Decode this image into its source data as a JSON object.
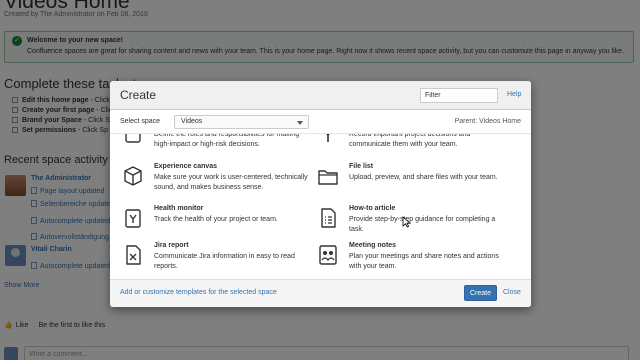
{
  "page": {
    "title": "Videos Home",
    "created_by": "Created by The Administrator on Feb 08, 2018"
  },
  "welcome": {
    "title": "Welcome to your new space!",
    "body": "Confluence spaces are great for sharing content and news with your team. This is your home page. Right now it shows recent space activity, but you can customize this page in anyway you like."
  },
  "tasks": {
    "heading": "Complete these tasks to",
    "items": [
      {
        "label": "Edit this home page",
        "rest": " - Click"
      },
      {
        "label": "Create your first page",
        "rest": " - Click"
      },
      {
        "label": "Brand your Space",
        "rest": " - Click Sp"
      },
      {
        "label": "Set permissions",
        "rest": " - Click Sp"
      }
    ]
  },
  "recent": {
    "heading": "Recent space activity",
    "groups": [
      {
        "user": "The Administrator",
        "lines": [
          "Page layout updated",
          "Seitenbereiche updated",
          "Autocomplete updated",
          "Autovervollständigung"
        ]
      },
      {
        "user": "Vitali Charin",
        "lines": [
          "Autocomplete updated"
        ]
      }
    ],
    "show_more": "Show More"
  },
  "like": {
    "label": "Like",
    "text": "Be the first to like this"
  },
  "comment": {
    "placeholder": "Write a comment..."
  },
  "dialog": {
    "title": "Create",
    "filter_placeholder": "Filter",
    "help": "Help",
    "select_space_label": "Select space",
    "selected_space": "Videos",
    "parent": "Parent: Videos Home",
    "templates": [
      {
        "name": "",
        "desc": "Define the roles and responsibilities for making high-impact or high-risk decisions.",
        "icon": "roles-icon"
      },
      {
        "name": "",
        "desc": "Record important project decisions and communicate them with your team.",
        "icon": "decision-icon"
      },
      {
        "name": "Experience canvas",
        "desc": "Make sure your work is user-centered, technically sound, and makes business sense.",
        "icon": "cube-icon"
      },
      {
        "name": "File list",
        "desc": "Upload, preview, and share files with your team.",
        "icon": "folder-icon"
      },
      {
        "name": "Health monitor",
        "desc": "Track the health of your project or team.",
        "icon": "health-monitor-icon"
      },
      {
        "name": "How-to article",
        "desc": "Provide step-by-step guidance for completing a task.",
        "icon": "how-to-icon"
      },
      {
        "name": "Jira report",
        "desc": "Communicate Jira information in easy to read reports.",
        "icon": "jira-report-icon"
      },
      {
        "name": "Meeting notes",
        "desc": "Plan your meetings and share notes and actions with your team.",
        "icon": "meeting-notes-icon"
      }
    ],
    "footer_link": "Add or customize templates for the selected space",
    "create_button": "Create",
    "close": "Close"
  },
  "colors": {
    "link": "#3572b0",
    "primary_button": "#3572b0",
    "success": "#14892c"
  }
}
